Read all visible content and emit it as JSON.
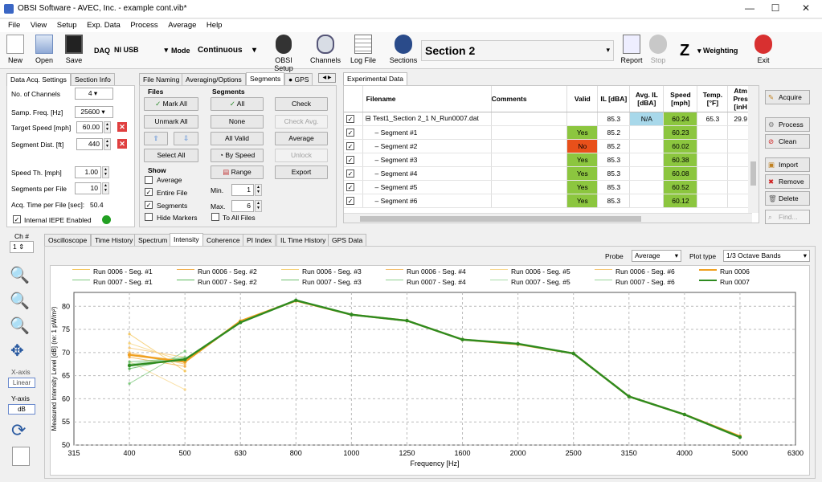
{
  "window": {
    "title": "OBSI Software - AVEC, Inc. - example cont.vib*"
  },
  "menu": [
    "File",
    "View",
    "Setup",
    "Exp. Data",
    "Process",
    "Average",
    "Help"
  ],
  "toolbar": {
    "new": "New",
    "open": "Open",
    "save": "Save",
    "daq_label": "DAQ",
    "daq_value": "NI USB",
    "mode_label": "Mode",
    "mode_value": "Continuous",
    "obsi_setup": "OBSI Setup",
    "channels": "Channels",
    "log_file": "Log File",
    "sections": "Sections",
    "section_value": "Section 2",
    "report": "Report",
    "stop": "Stop",
    "weighting_letter": "Z",
    "weighting": "Weighting",
    "exit": "Exit"
  },
  "left_tabs": [
    "Data Acq. Settings",
    "Section Info"
  ],
  "settings": {
    "channels_label": "No. of Channels",
    "channels_value": "4",
    "samp_label": "Samp. Freq. [Hz]",
    "samp_value": "25600",
    "target_label": "Target Speed [mph]",
    "target_value": "60.00",
    "segdist_label": "Segment Dist. [ft]",
    "segdist_value": "440",
    "speedth_label": "Speed Th. [mph]",
    "speedth_value": "1.00",
    "segfile_label": "Segments per File",
    "segfile_value": "10",
    "acq_label": "Acq. Time per File [sec]:",
    "acq_value": "50.4",
    "iepe_label": "Internal IEPE Enabled"
  },
  "mid_tabs": [
    "File Naming",
    "Averaging/Options",
    "Segments",
    "GPS"
  ],
  "files": {
    "header": "Files",
    "mark_all": "Mark All",
    "unmark_all": "Unmark All",
    "select_all": "Select All"
  },
  "segments": {
    "header": "Segments",
    "all": "All",
    "none": "None",
    "all_valid": "All Valid",
    "by_speed": "By Speed",
    "range": "Range",
    "min_label": "Min.",
    "min_value": "1",
    "max_label": "Max.",
    "max_value": "6",
    "to_all_files": "To All Files"
  },
  "check_buttons": {
    "check": "Check",
    "check_avg": "Check Avg.",
    "average": "Average",
    "unlock": "Unlock",
    "export": "Export"
  },
  "show": {
    "header": "Show",
    "average": "Average",
    "entire_file": "Entire File",
    "segments": "Segments",
    "hide_markers": "Hide Markers"
  },
  "exp_tab": "Experimental Data",
  "grid": {
    "headers": [
      "Filename",
      "Comments",
      "Valid",
      "IL [dBA]",
      "Avg. IL [dBA]",
      "Speed [mph]",
      "Temp. [°F]",
      "Atm Pres [inH"
    ],
    "rows": [
      {
        "name": "Test1_Section 2_1 N_Run0007.dat",
        "valid": "",
        "il": "85.3",
        "avg": "N/A",
        "speed": "60.24",
        "temp": "65.3",
        "atm": "29.9"
      },
      {
        "name": "Segment #1",
        "valid": "Yes",
        "il": "85.2",
        "avg": "",
        "speed": "60.23",
        "temp": "",
        "atm": ""
      },
      {
        "name": "Segment #2",
        "valid": "No",
        "il": "85.2",
        "avg": "",
        "speed": "60.02",
        "temp": "",
        "atm": ""
      },
      {
        "name": "Segment #3",
        "valid": "Yes",
        "il": "85.3",
        "avg": "",
        "speed": "60.38",
        "temp": "",
        "atm": ""
      },
      {
        "name": "Segment #4",
        "valid": "Yes",
        "il": "85.3",
        "avg": "",
        "speed": "60.08",
        "temp": "",
        "atm": ""
      },
      {
        "name": "Segment #5",
        "valid": "Yes",
        "il": "85.3",
        "avg": "",
        "speed": "60.52",
        "temp": "",
        "atm": ""
      },
      {
        "name": "Segment #6",
        "valid": "Yes",
        "il": "85.3",
        "avg": "",
        "speed": "60.12",
        "temp": "",
        "atm": ""
      }
    ]
  },
  "right_buttons": [
    "Acquire",
    "Process",
    "Clean",
    "Import",
    "Remove",
    "Delete",
    "Find..."
  ],
  "left_tools": {
    "ch_label": "Ch #",
    "ch_value": "1",
    "xaxis": "X-axis",
    "xaxis_value": "Linear",
    "yaxis": "Y-axis",
    "yaxis_value": "dB"
  },
  "plot_tabs": [
    "Oscilloscope",
    "Time History",
    "Spectrum",
    "Intensity",
    "Coherence",
    "PI Index",
    "IL Time History",
    "GPS Data"
  ],
  "plot_opts": {
    "probe_label": "Probe",
    "probe_value": "Average",
    "plottype_label": "Plot type",
    "plottype_value": "1/3 Octave Bands"
  },
  "chart_data": {
    "type": "line",
    "xlabel": "Frequency [Hz]",
    "ylabel": "Measured Intensity Level [dB] (re: 1 pW/m²)",
    "categories": [
      "315",
      "400",
      "500",
      "630",
      "800",
      "1000",
      "1250",
      "1600",
      "2000",
      "2500",
      "3150",
      "4000",
      "5000",
      "6300"
    ],
    "ylim": [
      50,
      83
    ],
    "yticks": [
      50,
      55,
      60,
      65,
      70,
      75,
      80
    ],
    "series": [
      {
        "name": "Run 0006 - Seg. #1",
        "color": "#f5c860",
        "values": [
          null,
          74,
          66,
          null
        ]
      },
      {
        "name": "Run 0006 - Seg. #2",
        "color": "#f2b050",
        "values": [
          null,
          69,
          67,
          null
        ]
      },
      {
        "name": "Run 0006 - Seg. #3",
        "color": "#f6d27a",
        "values": [
          null,
          72,
          68,
          null
        ]
      },
      {
        "name": "Run 0006 - Seg. #4",
        "color": "#f4c070",
        "values": [
          null,
          70,
          67.5,
          null
        ]
      },
      {
        "name": "Run 0006 - Seg. #5",
        "color": "#f8d890",
        "values": [
          null,
          68,
          62,
          null
        ]
      },
      {
        "name": "Run 0006 - Seg. #6",
        "color": "#f5c878",
        "values": [
          null,
          71,
          69,
          null
        ]
      },
      {
        "name": "Run 0007 - Seg. #1",
        "color": "#7fc97f",
        "values": [
          null,
          63.3,
          70.3,
          null
        ]
      },
      {
        "name": "Run 0007 - Seg. #2",
        "color": "#5cb85c",
        "values": [
          null,
          66.5,
          69,
          null
        ]
      },
      {
        "name": "Run 0007 - Seg. #3",
        "color": "#6fbf6f",
        "values": [
          null,
          68,
          68.8,
          null
        ]
      },
      {
        "name": "Run 0007 - Seg. #4",
        "color": "#8ed08e",
        "values": [
          null,
          67.5,
          69,
          null
        ]
      },
      {
        "name": "Run 0007 - Seg. #5",
        "color": "#a8dca8",
        "values": [
          null,
          67,
          68.7,
          null
        ]
      },
      {
        "name": "Run 0007 - Seg. #6",
        "color": "#99d499",
        "values": [
          null,
          67.2,
          68.9,
          null
        ]
      },
      {
        "name": "Run 0006",
        "color": "#f0a020",
        "values": [
          null,
          69.5,
          68,
          76.8,
          81.2,
          78.2,
          76.9,
          72.8,
          71.8,
          69.8,
          60.5,
          56.6,
          51.9,
          null
        ]
      },
      {
        "name": "Run 0007",
        "color": "#2e8b20",
        "values": [
          null,
          67.2,
          68.5,
          76.5,
          81.3,
          78.2,
          76.9,
          72.8,
          71.9,
          69.8,
          60.5,
          56.6,
          51.7,
          null
        ]
      }
    ]
  }
}
